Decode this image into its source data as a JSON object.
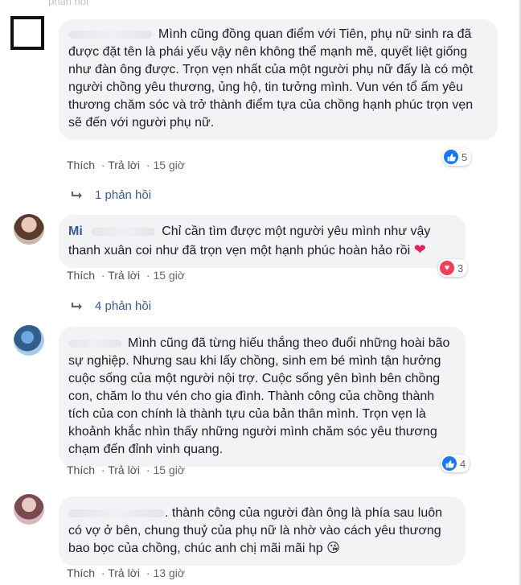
{
  "top_fragment": "phản hồi",
  "comments": [
    {
      "author": "",
      "text": "Mình cũng đồng quan điểm với Tiên, phụ nữ sinh ra đã được đặt tên là phái yếu vậy nên không thể mạnh mẽ, quyết liệt giống như đàn ông được. Trọn vẹn nhất của một người phụ nữ đấy là có một người chồng yêu thương, ủng hộ, tin tưởng mình. Vun vén tổ ấm yêu thương chăm sóc và trở thành điểm tựa của chồng hạnh phúc trọn vẹn sẽ đến với người phụ nữ.",
      "reaction_count": "5",
      "reaction_icon": "like-icon",
      "like_label": "Thích",
      "reply_label": "Trả lời",
      "time": "15 giờ",
      "replies": "1 phản hồi"
    },
    {
      "author": "Mi",
      "text": "Chỉ cần tìm được một người yêu mình như vậy thanh xuân coi như đã trọn vẹn một hạnh phúc hoàn hảo rồi",
      "emoji": "❤",
      "reaction_count": "3",
      "reaction_icon": "heart-icon",
      "like_label": "Thích",
      "reply_label": "Trả lời",
      "time": "15 giờ",
      "replies": "4 phản hồi"
    },
    {
      "author": "",
      "text": "Mình cũng đã từng hiếu thắng theo đuổi những hoài bão sự nghiệp. Nhưng sau khi lấy chồng, sinh em bé mình tận hưởng cuộc sống của một người nội trợ. Cuộc sống yên bình bên chồng con, chăm lo thu vén cho gia đình. Thành công của chồng thành tích của con chính là thành tựu của bản thân mình. Trọn vẹn là khoảnh khắc nhìn thấy những người mình chăm sóc yêu thương chạm đến đỉnh vinh quang.",
      "reaction_count": "4",
      "reaction_icon": "like-icon",
      "like_label": "Thích",
      "reply_label": "Trả lời",
      "time": "15 giờ"
    },
    {
      "author": "",
      "text": ". thành công của người đàn ông là phía sau luôn có vợ ở bên, chung thuỷ của phụ nữ là nhờ vào cách yêu thương bao bọc của chồng, chúc anh chị mãi mãi hp",
      "emoji": "😘",
      "like_label": "Thích",
      "reply_label": "Trả lời",
      "time": "13 giờ"
    }
  ],
  "colors": {
    "bubble": "#f2f3f5",
    "link": "#385898",
    "like": "#1877f2",
    "heart": "#f33e58"
  }
}
